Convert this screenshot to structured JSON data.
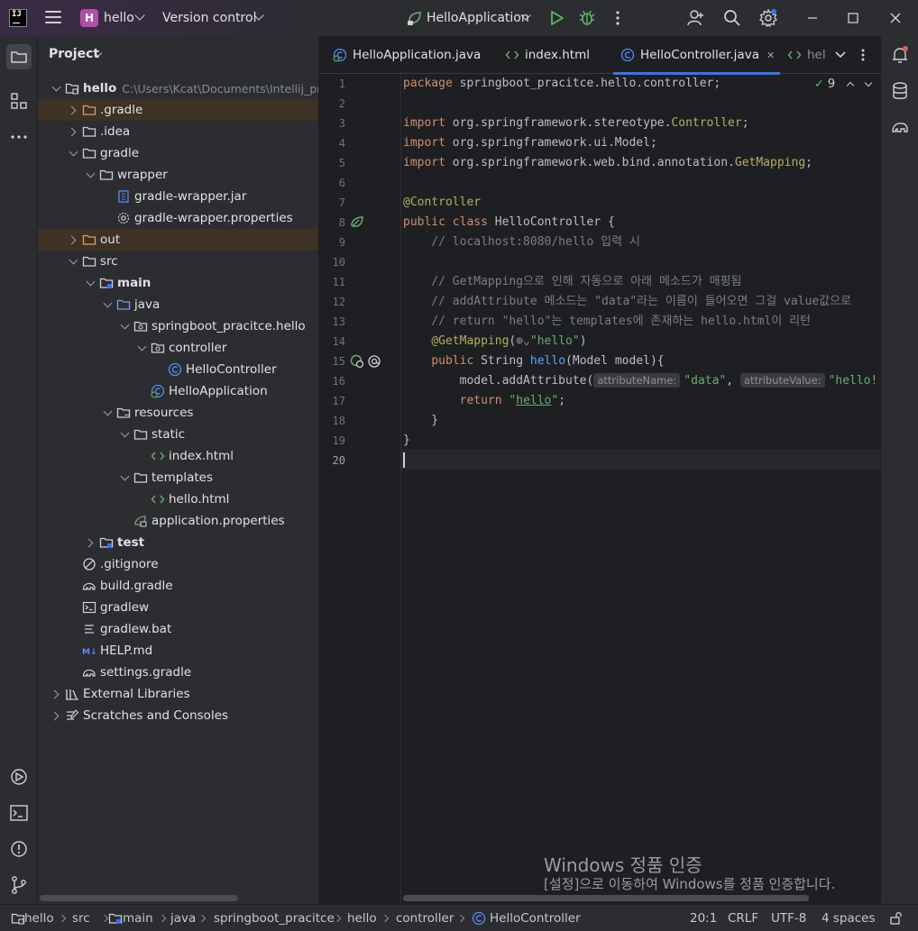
{
  "titlebar": {
    "project_initial": "H",
    "project_name": "hello",
    "version_control": "Version control",
    "run_config": "HelloApplication"
  },
  "project_panel": {
    "title": "Project",
    "tree": [
      {
        "label": "hello",
        "path": "C:\\Users\\Kcat\\Documents\\Intellij_pr",
        "icon": "module-folder-icon",
        "depth": 0,
        "state": "open",
        "bold": true
      },
      {
        "label": ".gradle",
        "icon": "excluded-folder-icon",
        "depth": 1,
        "state": "closed",
        "excluded": true
      },
      {
        "label": ".idea",
        "icon": "folder-icon",
        "depth": 1,
        "state": "closed"
      },
      {
        "label": "gradle",
        "icon": "folder-icon",
        "depth": 1,
        "state": "open"
      },
      {
        "label": "wrapper",
        "icon": "folder-icon",
        "depth": 2,
        "state": "open"
      },
      {
        "label": "gradle-wrapper.jar",
        "icon": "jar-icon",
        "depth": 3,
        "state": "none"
      },
      {
        "label": "gradle-wrapper.properties",
        "icon": "gear-icon",
        "depth": 3,
        "state": "none"
      },
      {
        "label": "out",
        "icon": "excluded-folder-icon",
        "depth": 1,
        "state": "closed",
        "excluded": true
      },
      {
        "label": "src",
        "icon": "folder-icon",
        "depth": 1,
        "state": "open"
      },
      {
        "label": "main",
        "icon": "source-folder-icon",
        "depth": 2,
        "state": "open",
        "bold": true
      },
      {
        "label": "java",
        "icon": "java-source-folder-icon",
        "depth": 3,
        "state": "open"
      },
      {
        "label": "springboot_pracitce.hello",
        "icon": "package-icon",
        "depth": 4,
        "state": "open"
      },
      {
        "label": "controller",
        "icon": "package-icon",
        "depth": 5,
        "state": "open"
      },
      {
        "label": "HelloController",
        "icon": "class-icon",
        "depth": 6,
        "state": "none"
      },
      {
        "label": "HelloApplication",
        "icon": "spring-class-icon",
        "depth": 5,
        "state": "none"
      },
      {
        "label": "resources",
        "icon": "resources-folder-icon",
        "depth": 3,
        "state": "open"
      },
      {
        "label": "static",
        "icon": "folder-icon",
        "depth": 4,
        "state": "open"
      },
      {
        "label": "index.html",
        "icon": "html-icon",
        "depth": 5,
        "state": "none"
      },
      {
        "label": "templates",
        "icon": "folder-icon",
        "depth": 4,
        "state": "open"
      },
      {
        "label": "hello.html",
        "icon": "html-icon",
        "depth": 5,
        "state": "none"
      },
      {
        "label": "application.properties",
        "icon": "spring-properties-icon",
        "depth": 4,
        "state": "none"
      },
      {
        "label": "test",
        "icon": "source-folder-icon",
        "depth": 2,
        "state": "closed",
        "bold": true
      },
      {
        "label": ".gitignore",
        "icon": "ignore-file-icon",
        "depth": 1,
        "state": "none"
      },
      {
        "label": "build.gradle",
        "icon": "gradle-icon",
        "depth": 1,
        "state": "none"
      },
      {
        "label": "gradlew",
        "icon": "terminal-file-icon",
        "depth": 1,
        "state": "none"
      },
      {
        "label": "gradlew.bat",
        "icon": "text-file-icon",
        "depth": 1,
        "state": "none"
      },
      {
        "label": "HELP.md",
        "icon": "markdown-icon",
        "depth": 1,
        "state": "none"
      },
      {
        "label": "settings.gradle",
        "icon": "gradle-icon",
        "depth": 1,
        "state": "none"
      },
      {
        "label": "External Libraries",
        "icon": "libraries-icon",
        "depth": 0,
        "state": "closed"
      },
      {
        "label": "Scratches and Consoles",
        "icon": "scratches-icon",
        "depth": 0,
        "state": "closed"
      }
    ]
  },
  "editor": {
    "tabs": [
      {
        "label": "HelloApplication.java",
        "icon": "spring-class-icon",
        "active": false
      },
      {
        "label": "index.html",
        "icon": "html-icon",
        "active": false
      },
      {
        "label": "HelloController.java",
        "icon": "class-icon",
        "active": true
      },
      {
        "label": "hel",
        "icon": "html-icon",
        "active": false
      }
    ],
    "inspection_count": "9",
    "hints": {
      "attribute_name": "attributeName:",
      "attribute_value": "attributeValue:"
    },
    "line_numbers": [
      "1",
      "2",
      "3",
      "4",
      "5",
      "6",
      "7",
      "8",
      "9",
      "10",
      "11",
      "12",
      "13",
      "14",
      "15",
      "16",
      "17",
      "18",
      "19",
      "20"
    ]
  },
  "watermark": {
    "title": "Windows 정품 인증",
    "subtitle": "[설정]으로 이동하여 Windows를 정품 인증합니다."
  },
  "statusbar": {
    "breadcrumbs": [
      "hello",
      "src",
      "main",
      "java",
      "springboot_pracitce",
      "hello",
      "controller",
      "HelloController"
    ],
    "position": "20:1",
    "line_separator": "CRLF",
    "encoding": "UTF-8",
    "indent": "4 spaces"
  }
}
